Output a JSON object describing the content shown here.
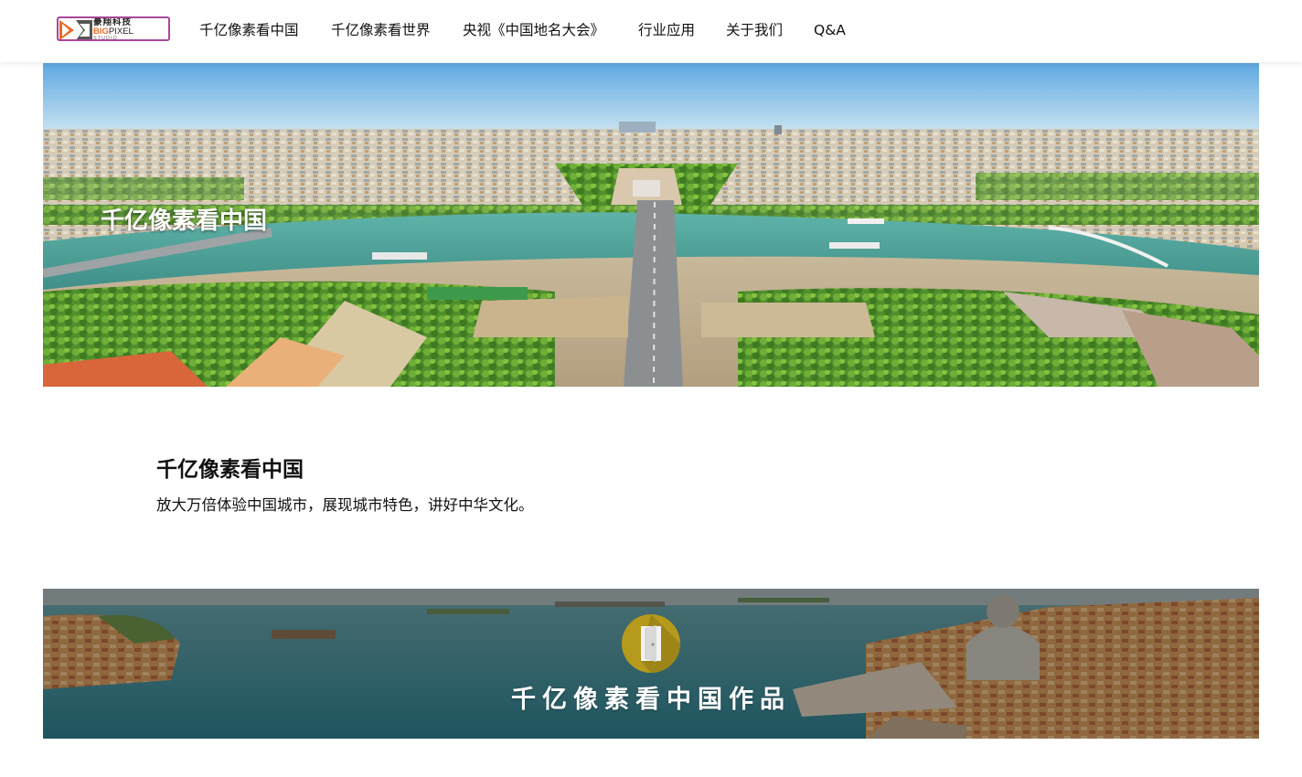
{
  "header": {
    "logo": {
      "name_cn": "豪翔科技",
      "name_en_accent": "BIG",
      "name_en_rest": "PIXEL",
      "name_sub": "STUDIO"
    },
    "nav": [
      {
        "label": "千亿像素看中国"
      },
      {
        "label": "千亿像素看世界"
      },
      {
        "label": "央视《中国地名大会》"
      },
      {
        "label": "行业应用"
      },
      {
        "label": "关于我们"
      },
      {
        "label": "Q&A"
      }
    ]
  },
  "hero": {
    "title": "千亿像素看中国"
  },
  "intro": {
    "title": "千亿像素看中国",
    "description": "放大万倍体验中国城市，展现城市特色，讲好中华文化。"
  },
  "works": {
    "title": "千亿像素看中国作品",
    "icon": "door-icon"
  },
  "colors": {
    "logo_border": "#a8489a",
    "logo_orange": "#ea6a1e",
    "door_circle": "#b59a1c",
    "river": "#4fa59c",
    "sky": "#8fc3e3"
  }
}
